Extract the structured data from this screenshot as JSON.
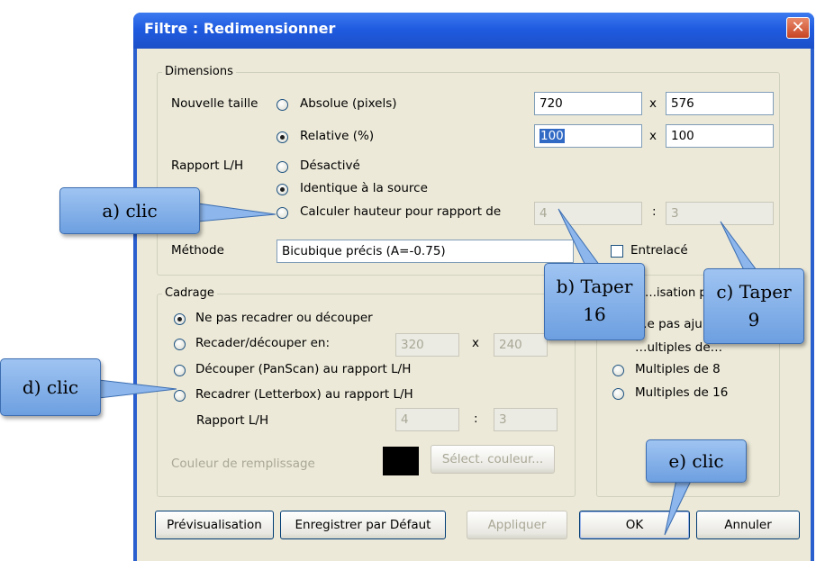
{
  "window": {
    "title": "Filtre : Redimensionner",
    "close_glyph": "✕"
  },
  "dimensions": {
    "legend": "Dimensions",
    "nouvelle_taille_label": "Nouvelle taille",
    "absolue_label": "Absolue (pixels)",
    "absolue_width": "720",
    "absolue_height": "576",
    "relative_label": "Relative (%)",
    "relative_width": "100",
    "relative_height": "100",
    "x_sep": "x",
    "rapport_label": "Rapport L/H",
    "desactive_label": "Désactivé",
    "identique_label": "Identique à la source",
    "calculer_label": "Calculer hauteur pour rapport de",
    "ratio_w": "4",
    "ratio_h": "3",
    "colon": ":",
    "methode_label": "Méthode",
    "methode_value": "Bicubique précis (A=-0.75)",
    "entrelace_label": "Entrelacé"
  },
  "cadrage": {
    "legend": "Cadrage",
    "ne_pas_label": "Ne pas recadrer ou découper",
    "recader_label": "Recader/découper en:",
    "crop_w": "320",
    "crop_h": "240",
    "x_sep": "x",
    "panscan_label": "Découper (PanScan) au rapport L/H",
    "letterbox_label": "Recadrer (Letterbox) au rapport L/H",
    "rapport_label": "Rapport L/H",
    "lb_w": "4",
    "lb_h": "3",
    "colon": ":",
    "couleur_label": "Couleur de remplissage",
    "couleur_button": "Sélect. couleur..."
  },
  "ajust": {
    "legend": "…isation po…",
    "opt1": "…e pas aju…",
    "opt2": "…ultiples de…",
    "opt3": "Multiples de 8",
    "opt4": "Multiples de 16"
  },
  "buttons": {
    "preview": "Prévisualisation",
    "save_default": "Enregistrer par Défaut",
    "apply": "Appliquer",
    "ok": "OK",
    "cancel": "Annuler"
  },
  "callouts": {
    "a": "a) clic",
    "b_line1": "b) Taper",
    "b_line2": "16",
    "c_line1": "c) Taper",
    "c_line2": "9",
    "d": "d) clic",
    "e": "e) clic"
  },
  "colors": {
    "titlebar": "#1f5be0",
    "dialog_bg": "#ece9d8",
    "callout": "#8cb6ec",
    "selection": "#316ac5"
  }
}
